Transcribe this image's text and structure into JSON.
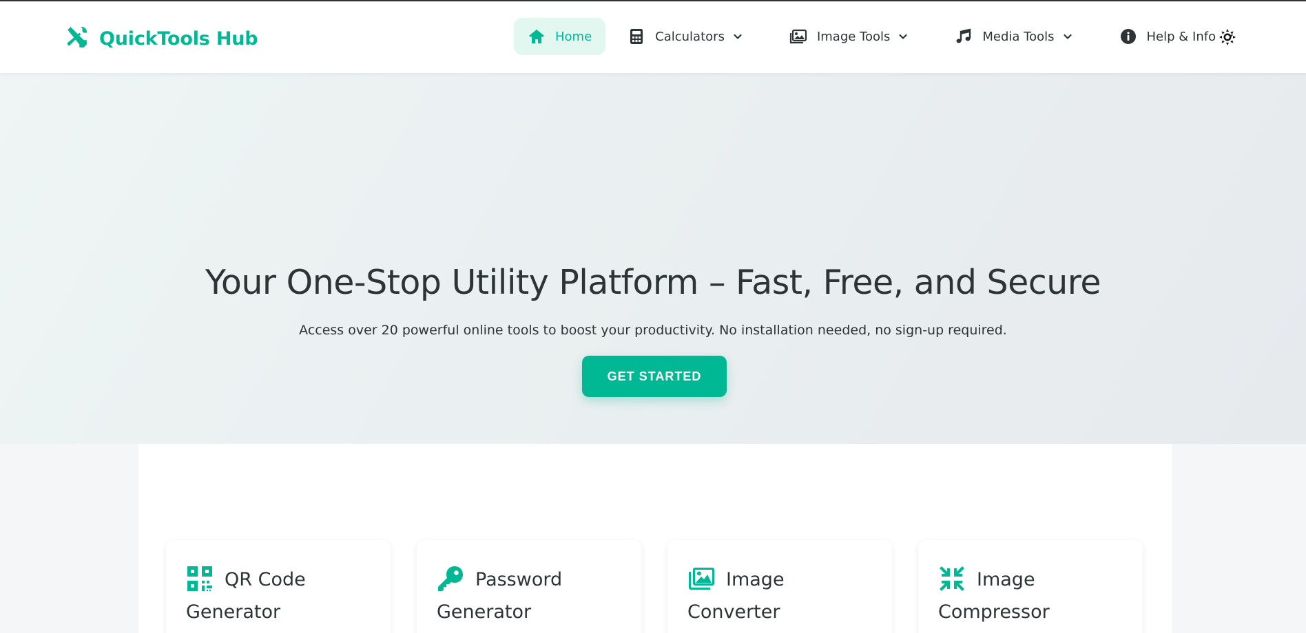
{
  "brand": {
    "name": "QuickTools Hub",
    "icon": "tools-icon",
    "color": "#00b894"
  },
  "nav": {
    "items": [
      {
        "label": "Home",
        "icon": "home-icon",
        "active": true,
        "dropdown": false
      },
      {
        "label": "Calculators",
        "icon": "calculator-icon",
        "active": false,
        "dropdown": true
      },
      {
        "label": "Image Tools",
        "icon": "images-icon",
        "active": false,
        "dropdown": true
      },
      {
        "label": "Media Tools",
        "icon": "music-icon",
        "active": false,
        "dropdown": true
      },
      {
        "label": "Help & Info",
        "icon": "info-icon",
        "active": false,
        "dropdown": true
      }
    ],
    "theme_toggle_icon": "sun-icon"
  },
  "hero": {
    "title": "Your One-Stop Utility Platform – Fast, Free, and Secure",
    "subtitle": "Access over 20 powerful online tools to boost your productivity. No installation needed, no sign-up required.",
    "cta_label": "GET STARTED"
  },
  "tools": {
    "cards": [
      {
        "title": "QR Code Generator",
        "icon": "qrcode-icon"
      },
      {
        "title": "Password Generator",
        "icon": "key-icon"
      },
      {
        "title": "Image Converter",
        "icon": "images-icon"
      },
      {
        "title": "Image Compressor",
        "icon": "compress-icon"
      }
    ]
  },
  "colors": {
    "accent": "#00b894",
    "accent_light": "#e3f7f1",
    "text": "#2d3436"
  }
}
